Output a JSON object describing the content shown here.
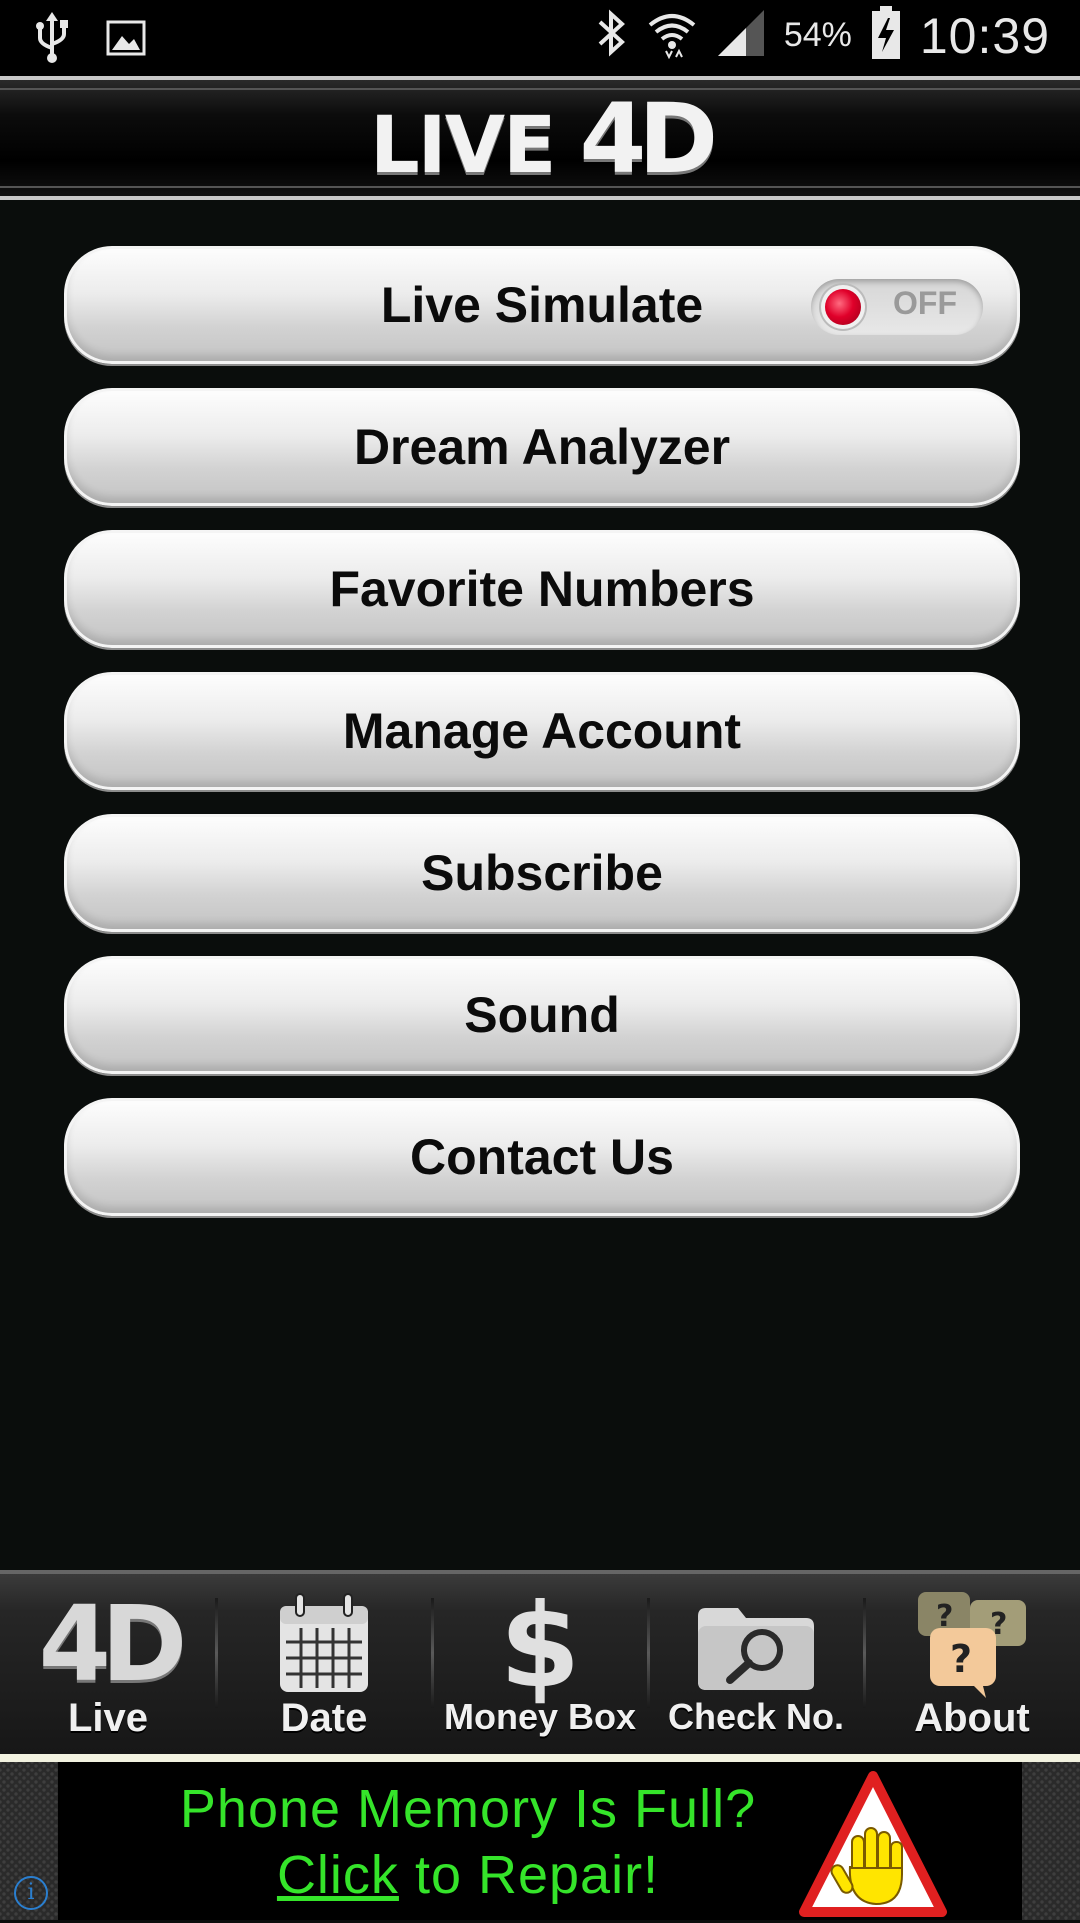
{
  "status_bar": {
    "battery_percent": "54%",
    "time": "10:39",
    "icons": [
      "usb-icon",
      "image-icon",
      "bluetooth-icon",
      "wifi-icon",
      "signal-icon",
      "battery-charging-icon"
    ]
  },
  "header": {
    "logo_word": "LIVE",
    "logo_mark": "4D"
  },
  "menu": {
    "items": [
      {
        "label": "Live Simulate",
        "toggle": {
          "state": "OFF",
          "on": false
        }
      },
      {
        "label": "Dream Analyzer"
      },
      {
        "label": "Favorite Numbers"
      },
      {
        "label": "Manage Account"
      },
      {
        "label": "Subscribe"
      },
      {
        "label": "Sound"
      },
      {
        "label": "Contact Us"
      }
    ]
  },
  "tabbar": {
    "tabs": [
      {
        "label": "Live",
        "icon": "4d-icon",
        "icon_text": "4D"
      },
      {
        "label": "Date",
        "icon": "calendar-icon"
      },
      {
        "label": "Money Box",
        "icon": "dollar-icon",
        "icon_text": "$"
      },
      {
        "label": "Check No.",
        "icon": "folder-search-icon"
      },
      {
        "label": "About",
        "icon": "question-bubbles-icon"
      }
    ]
  },
  "ad": {
    "line1": "Phone Memory Is Full?",
    "line2_link": "Click",
    "line2_rest": " to Repair!",
    "info_glyph": "i"
  },
  "colors": {
    "background": "#0a0d0c",
    "ad_text": "#35e42a",
    "toggle_dot": "#e0002a"
  }
}
